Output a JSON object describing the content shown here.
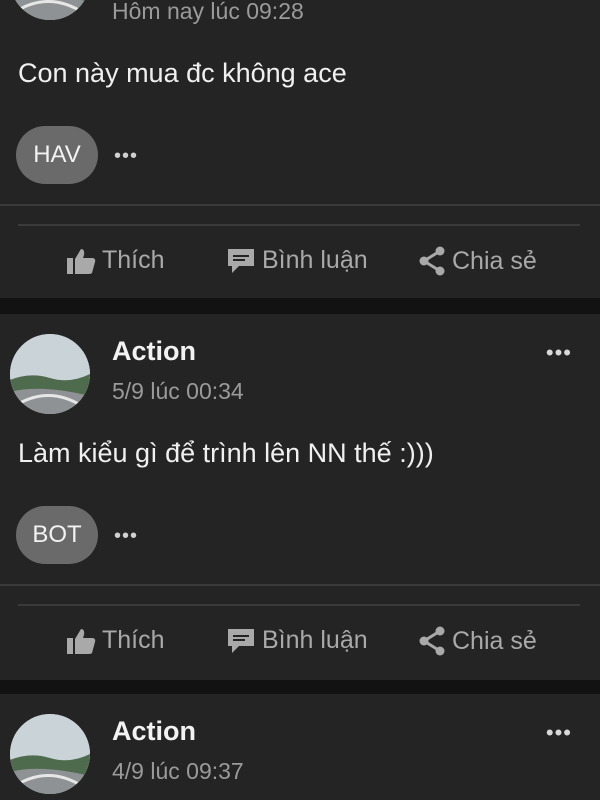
{
  "posts": [
    {
      "time": "Hôm nay lúc 09:28",
      "text": "Con này mua đc không ace",
      "reaction_label": "HAV",
      "more_glyph": "•••"
    },
    {
      "author": "Action",
      "time": "5/9 lúc 00:34",
      "text": "Làm kiểu gì để trình lên NN thế :)))",
      "reaction_label": "BOT",
      "more_glyph": "•••"
    },
    {
      "author": "Action",
      "time": "4/9 lúc 09:37",
      "more_glyph": "•••"
    }
  ],
  "actions": {
    "like": "Thích",
    "comment": "Bình luận",
    "share": "Chia sẻ"
  },
  "icons": {
    "like": "thumbs-up-icon",
    "comment": "comment-icon",
    "share": "share-icon",
    "more": "more-dots-icon"
  },
  "colors": {
    "background": "#121212",
    "card": "#242424",
    "text": "#f0f0f0",
    "muted": "#9a9a9a",
    "action": "#a9a9a9",
    "pill": "#6a6a6a"
  }
}
